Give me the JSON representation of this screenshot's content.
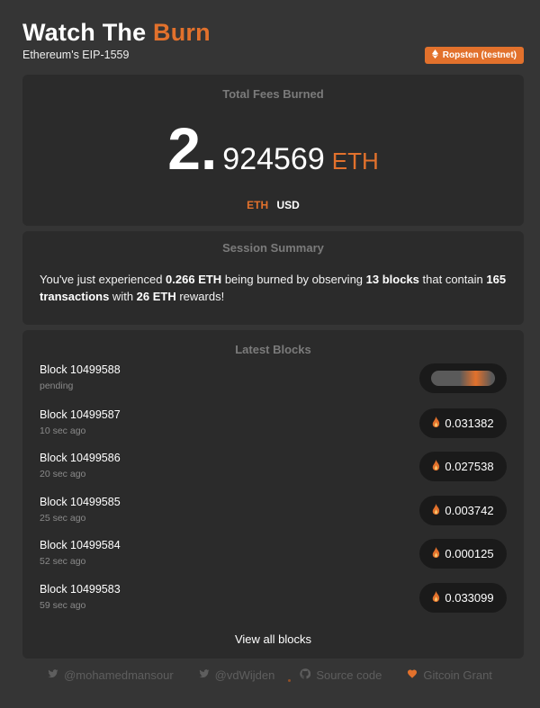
{
  "header": {
    "title_main": "Watch The ",
    "title_accent": "Burn",
    "subtitle": "Ethereum's EIP-1559",
    "network_badge": "Ropsten (testnet)"
  },
  "fees": {
    "title": "Total Fees Burned",
    "integer_part": "2.",
    "decimal_part": "924569",
    "unit": "ETH",
    "toggle_eth": "ETH",
    "toggle_usd": "USD"
  },
  "session": {
    "title": "Session Summary",
    "text_1": "You've just experienced ",
    "burned": "0.266 ETH",
    "text_2": " being burned by observing ",
    "blocks": "13 blocks",
    "text_3": " that contain ",
    "transactions": "165 transactions",
    "text_4": " with ",
    "rewards": "26 ETH",
    "text_5": " rewards!"
  },
  "latest_blocks": {
    "title": "Latest Blocks",
    "rows": [
      {
        "name": "Block 10499588",
        "age": "pending",
        "burned": ""
      },
      {
        "name": "Block 10499587",
        "age": "10 sec ago",
        "burned": "0.031382"
      },
      {
        "name": "Block 10499586",
        "age": "20 sec ago",
        "burned": "0.027538"
      },
      {
        "name": "Block 10499585",
        "age": "25 sec ago",
        "burned": "0.003742"
      },
      {
        "name": "Block 10499584",
        "age": "52 sec ago",
        "burned": "0.000125"
      },
      {
        "name": "Block 10499583",
        "age": "59 sec ago",
        "burned": "0.033099"
      }
    ],
    "view_all": "View all blocks"
  },
  "footer": {
    "links": [
      {
        "label": "@mohamedmansour",
        "icon": "twitter-icon"
      },
      {
        "label": "@vdWijden",
        "icon": "twitter-icon"
      },
      {
        "label": "Source code",
        "icon": "github-icon"
      },
      {
        "label": "Gitcoin Grant",
        "icon": "heart-icon"
      }
    ]
  },
  "colors": {
    "accent": "#e2712c",
    "background": "#353535",
    "card": "#2b2b2b"
  }
}
